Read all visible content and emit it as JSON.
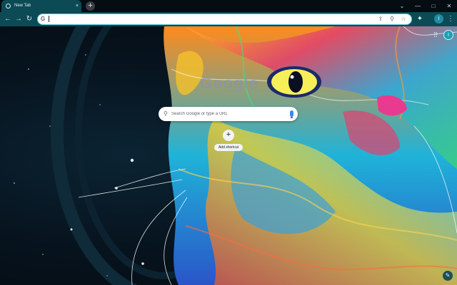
{
  "tab": {
    "title": "New Tab",
    "close_glyph": "×",
    "favicon": "chrome-icon"
  },
  "tabstrip": {
    "new_tab_glyph": "+"
  },
  "window": {
    "minimize": "—",
    "maximize": "□",
    "close": "✕",
    "tab_search": "⌄"
  },
  "toolbar": {
    "back": "←",
    "forward": "→",
    "reload": "↻",
    "omnibox_value": "",
    "omnibox_g": "G",
    "share_icon": "⇪",
    "search_icon": "⚲",
    "bookmark_icon": "☆",
    "extensions_icon": "✦",
    "profile_initial": "I",
    "menu_icon": "⋮"
  },
  "ntp": {
    "apps_icon": "⠿",
    "account_initial": "I",
    "logo_text": "Google",
    "search_placeholder": "Search Google or type a URL",
    "shortcut_add_glyph": "+",
    "shortcut_label": "Add shortcut",
    "customize_icon": "✎"
  },
  "colors": {
    "toolbar": "#0c4a55",
    "tabstrip": "#050d12",
    "accent": "#5ec8d8"
  }
}
